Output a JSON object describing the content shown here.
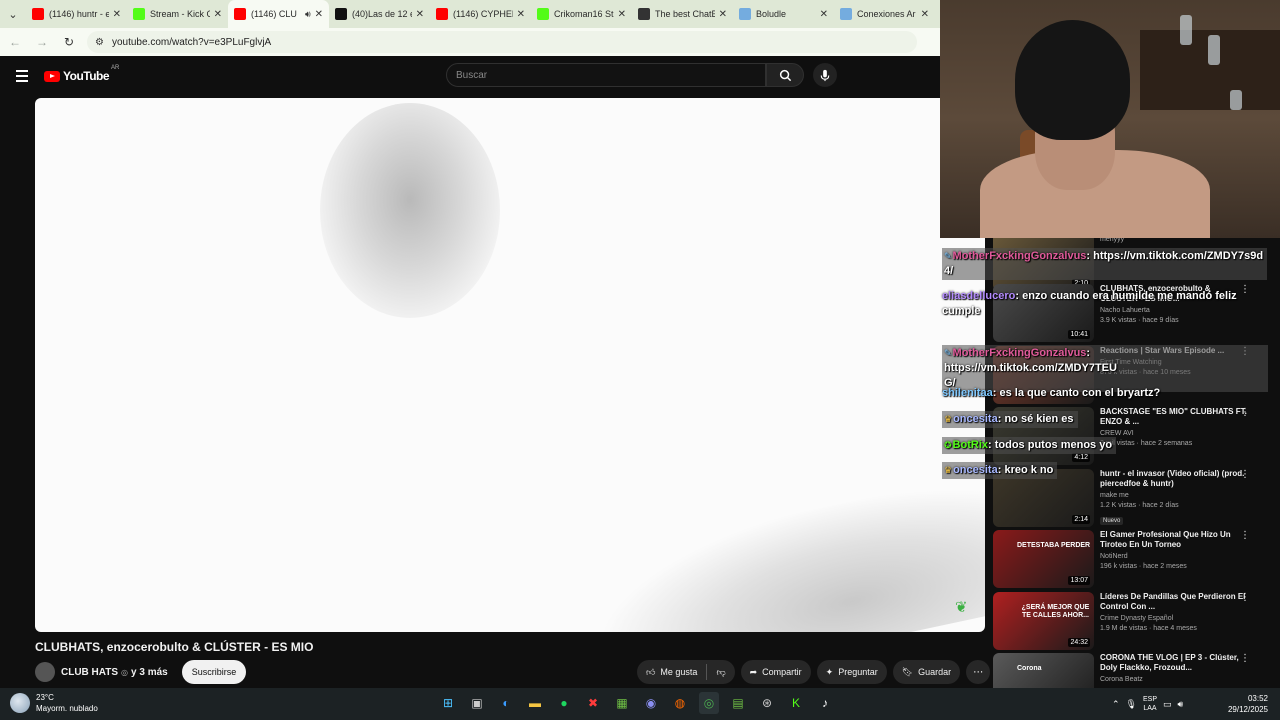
{
  "browser": {
    "tabs": [
      {
        "title": "(1146) huntr - el",
        "color": "#ff0000",
        "active": false,
        "speaker": false
      },
      {
        "title": "Stream - Kick C",
        "color": "#53fc18",
        "active": false,
        "speaker": false
      },
      {
        "title": "(1146) CLU",
        "color": "#ff0000",
        "active": true,
        "speaker": true
      },
      {
        "title": "(40)Las de 12 e",
        "color": "#111111",
        "active": false,
        "speaker": false
      },
      {
        "title": "(1146) CYPHER",
        "color": "#ff0000",
        "active": false,
        "speaker": false
      },
      {
        "title": "Crikoman16 St",
        "color": "#53fc18",
        "active": false,
        "speaker": false
      },
      {
        "title": "The best ChatB",
        "color": "#333333",
        "active": false,
        "speaker": false
      },
      {
        "title": "Boludle",
        "color": "#74acdf",
        "active": false,
        "speaker": false
      },
      {
        "title": "Conexiones Ar",
        "color": "#74acdf",
        "active": false,
        "speaker": false
      }
    ],
    "url": "youtube.com/watch?v=e3PLuFglvjA"
  },
  "youtube": {
    "logo_text": "YouTube",
    "country": "AR",
    "search_placeholder": "Buscar",
    "video_title": "CLUBHATS, enzocerobulto & CLÚSTER - ES MIO",
    "channel": "CLUB HATS",
    "channel_suffix": "y 3 más",
    "subscribe": "Suscribirse",
    "like": "Me gusta",
    "share": "Compartir",
    "ask": "Preguntar",
    "save": "Guardar"
  },
  "recommendations": [
    {
      "title": "",
      "channel": "menyyy",
      "meta": "",
      "duration": "2:10",
      "thumb": "#6b5a3a",
      "overlay": ""
    },
    {
      "title": "CLUBHATS, enzocerobulto & CLÚSTER - ES MIO...",
      "channel": "Nacho Lahuerta",
      "meta": "3.9 K vistas · hace 9 días",
      "duration": "10:41",
      "thumb": "#4a4a4a",
      "overlay": ""
    },
    {
      "title": "Reactions | Star Wars Episode ...",
      "channel": "First Time Watching",
      "meta": "876 k vistas · hace 10 meses",
      "duration": "",
      "thumb": "#7a3a2a",
      "overlay": ""
    },
    {
      "title": "BACKSTAGE \"ES MIO\" CLUBHATS FT. ENZO & ...",
      "channel": "CREW AVI",
      "meta": "2 mil vistas · hace 2 semanas",
      "duration": "4:12",
      "thumb": "#3a3a30",
      "overlay": ""
    },
    {
      "title": "huntr - el invasor (Video oficial) (prod. piercedfoe & huntr)",
      "channel": "make me",
      "meta": "1.2 K vistas · hace 2 días",
      "duration": "2:14",
      "thumb": "#3d3628",
      "overlay": "",
      "badge": "Nuevo"
    },
    {
      "title": "El Gamer Profesional Que Hizo Un Tiroteo En Un Torneo",
      "channel": "NotiNerd",
      "meta": "196 k vistas · hace 2 meses",
      "duration": "13:07",
      "thumb": "#8a1a1a",
      "overlay": "DETESTABA PERDER"
    },
    {
      "title": "Líderes De Pandillas Que Perdieron El Control Con ...",
      "channel": "Crime Dynasty Español",
      "meta": "1.9 M de vistas · hace 4 meses",
      "duration": "24:32",
      "thumb": "#b02020",
      "overlay": "¿SERÁ MEJOR QUE TE CALLES AHOR..."
    },
    {
      "title": "CORONA THE VLOG | EP 3 - Clúster, Doly Flackko, Frozoud...",
      "channel": "Corona Beatz",
      "meta": "",
      "duration": "",
      "thumb": "#5a5a5a",
      "overlay": "Corona"
    }
  ],
  "chat": [
    {
      "user": "MotherFxckingGonzalvus",
      "color": "#e05a9a",
      "text": "https://vm.tiktok.com/ZMDY7s9d",
      "cont": "4/",
      "icon": "pencil"
    },
    {
      "user": "eliasdellucero",
      "color": "#b48cff",
      "text": "enzo cuando era humilde me mandó feliz",
      "cont": "cumple",
      "icon": ""
    },
    {
      "user": "MotherFxckingGonzalvus",
      "color": "#e05a9a",
      "text": "https://vm.tiktok.com/ZMDY7TEU",
      "cont": "G/",
      "icon": "pencil"
    },
    {
      "user": "shilenitaa",
      "color": "#7ec8ff",
      "text": "es la que canto con el bryartz?",
      "cont": "",
      "icon": ""
    },
    {
      "user": "oncesita",
      "color": "#a8b8ff",
      "text": "no sé kien es",
      "cont": "",
      "icon": "crown"
    },
    {
      "user": "BotRix",
      "color": "#53fc18",
      "text": "todos putos menos yo",
      "cont": "",
      "icon": "bot"
    },
    {
      "user": "oncesita",
      "color": "#a8b8ff",
      "text": "kreo k no",
      "cont": "",
      "icon": "crown"
    }
  ],
  "taskbar": {
    "temperature": "23°C",
    "weather": "Mayorm. nublado",
    "lang": "ESP",
    "lang2": "LAA",
    "time": "03:52",
    "date": "29/12/2025"
  }
}
